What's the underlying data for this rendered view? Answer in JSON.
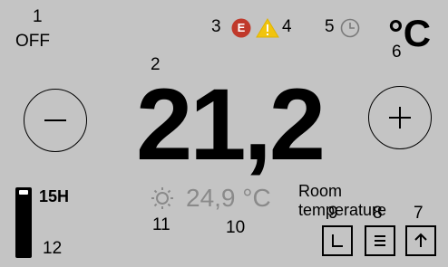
{
  "callouts": {
    "c1": "1",
    "c2": "2",
    "c3": "3",
    "c4": "4",
    "c5": "5",
    "c6": "6",
    "c7": "7",
    "c8": "8",
    "c9": "9",
    "c10": "10",
    "c11": "11",
    "c12": "12"
  },
  "status": {
    "power_label": "OFF",
    "error_badge": "E",
    "unit": "°C"
  },
  "setpoint": {
    "value": "21,2"
  },
  "room": {
    "label": "Room temperature",
    "value": "24,9 °C"
  },
  "timer": {
    "label": "15H",
    "level": 0.9
  },
  "icons": {
    "error": "error-badge-icon",
    "warning": "warning-triangle-icon",
    "clock": "clock-icon",
    "sun": "sun-icon",
    "minus": "minus-icon",
    "plus": "plus-icon",
    "schedule": "schedule-icon",
    "menu": "menu-icon",
    "up": "arrow-up-icon"
  },
  "colors": {
    "background": "#c4c4c4",
    "error": "#c0392b",
    "warning": "#f1c40f",
    "muted": "#8a8a8a"
  }
}
